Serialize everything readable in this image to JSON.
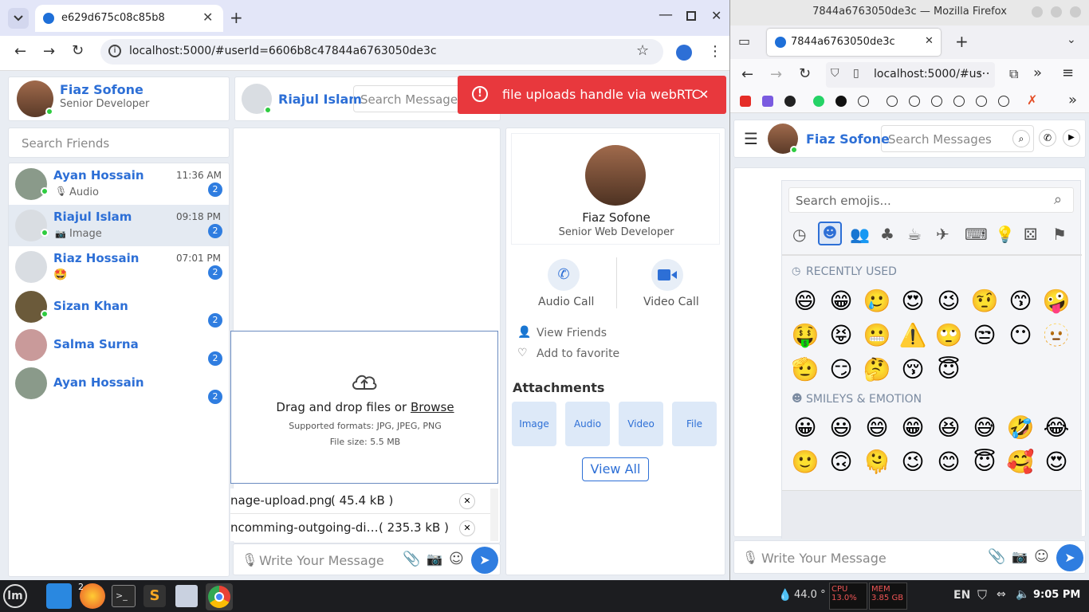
{
  "chrome": {
    "tab_title": "e629d675c08c85b8",
    "url": "localhost:5000/#userId=6606b8c47844a6763050de3c"
  },
  "me": {
    "name": "Fiaz Sofone",
    "role": "Senior Developer"
  },
  "chat_header": {
    "name": "Riajul Islam",
    "search_placeholder": "Search Messages"
  },
  "toast": {
    "text": "file uploads handle via webRTC",
    "color": "#e8383d"
  },
  "friends": {
    "search_placeholder": "Search Friends",
    "items": [
      {
        "name": "Ayan Hossain",
        "time": "11:36 AM",
        "preview": "Audio",
        "badge": "2"
      },
      {
        "name": "Riajul Islam",
        "time": "09:18 PM",
        "preview": "Image",
        "badge": "2"
      },
      {
        "name": "Riaz Hossain",
        "time": "07:01 PM",
        "preview": "🤩",
        "badge": "2"
      },
      {
        "name": "Sizan Khan",
        "time": "",
        "preview": "",
        "badge": "2"
      },
      {
        "name": "Salma Surna",
        "time": "",
        "preview": "",
        "badge": "2"
      },
      {
        "name": "Ayan Hossain",
        "time": "",
        "preview": "",
        "badge": "2"
      }
    ]
  },
  "upload": {
    "title": "Drag and drop files or ",
    "browse": "Browse",
    "formats": "Supported formats: JPG, JPEG, PNG",
    "size": "File size: 5.5 MB",
    "files": [
      {
        "name": "nage-upload.png",
        "size": "( 45.4 kB )"
      },
      {
        "name": "ncomming-outgoing-di…",
        "size": "( 235.3 kB )"
      }
    ]
  },
  "composer": {
    "placeholder": "Write Your Message"
  },
  "profile": {
    "name": "Fiaz Sofone",
    "role": "Senior Web Developer",
    "audio_call": "Audio Call",
    "video_call": "Video Call",
    "view_friends": "View Friends",
    "add_favorite": "Add to favorite",
    "attachments_title": "Attachments",
    "attachments": [
      "Image",
      "Audio",
      "Video",
      "File"
    ],
    "view_all": "View All"
  },
  "firefox": {
    "window_title": "7844a6763050de3c — Mozilla Firefox",
    "tab_title": "7844a6763050de3c",
    "url": "localhost:5000/#us",
    "chat_name": "Fiaz Sofone",
    "search_placeholder": "Search Messages",
    "emoji_search_placeholder": "Search emojis...",
    "recent_label": "RECENTLY USED",
    "smileys_label": "SMILEYS & EMOTION",
    "recent_emojis": [
      "😄",
      "😁",
      "🥲",
      "😍",
      "😉",
      "🤨",
      "😙",
      "🤪",
      "🤑",
      "😝",
      "😬",
      "⚠️",
      "🙄",
      "😒",
      "😶",
      "🫥",
      "🫡",
      "😏",
      "🤔",
      "😚",
      "😇"
    ],
    "smiley_emojis": [
      "😀",
      "😃",
      "😄",
      "😁",
      "😆",
      "😅",
      "🤣",
      "😂",
      "🙂",
      "🙃",
      "🫠",
      "😉",
      "😊",
      "😇",
      "🥰",
      "😍"
    ],
    "composer_placeholder": "Write Your Message"
  },
  "taskbar": {
    "firefox_count": "2",
    "temp": "44.0 °",
    "cpu": "CPU 13.0%",
    "mem": "MEM 3.85 GB",
    "lang": "EN",
    "clock": "9:05 PM"
  }
}
